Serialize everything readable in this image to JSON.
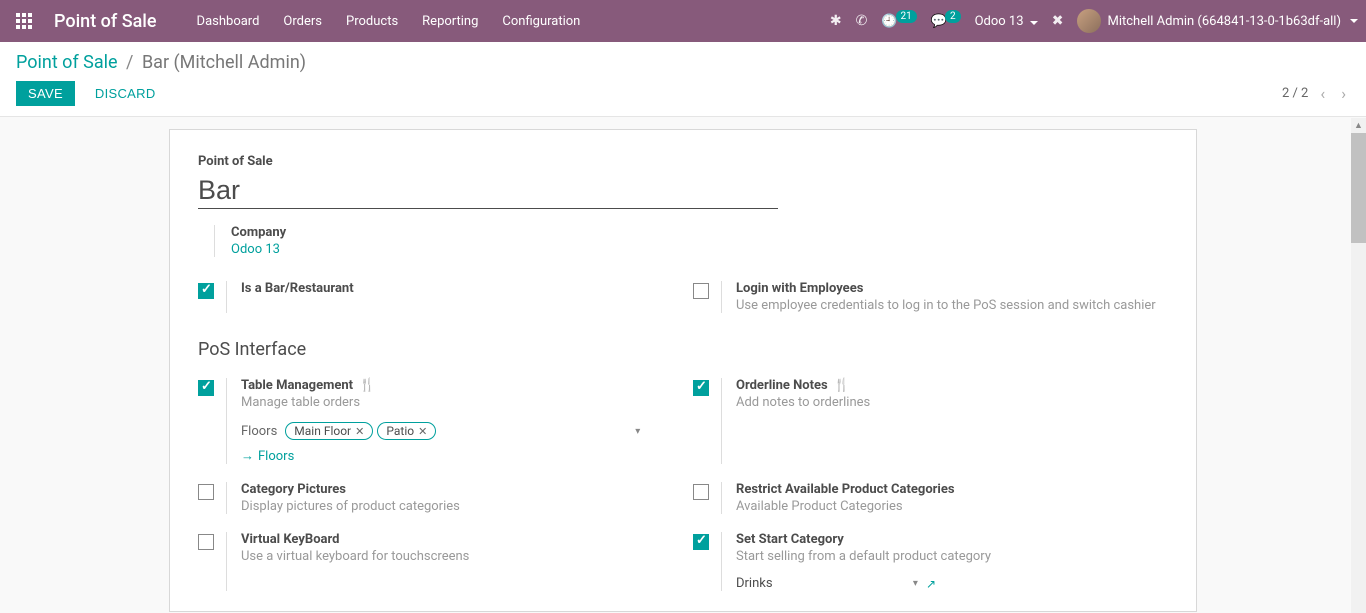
{
  "topnav": {
    "brand": "Point of Sale",
    "items": [
      "Dashboard",
      "Orders",
      "Products",
      "Reporting",
      "Configuration"
    ],
    "clock_badge": "21",
    "chat_badge": "2",
    "db_name": "Odoo 13",
    "user_name": "Mitchell Admin (664841-13-0-1b63df-all)"
  },
  "breadcrumb": {
    "root": "Point of Sale",
    "current": "Bar (Mitchell Admin)"
  },
  "actions": {
    "save": "SAVE",
    "discard": "DISCARD",
    "pager": "2 / 2"
  },
  "form": {
    "title_label": "Point of Sale",
    "title_value": "Bar",
    "company_label": "Company",
    "company_value": "Odoo 13",
    "section_pos_interface": "PoS Interface",
    "settings": {
      "is_bar": {
        "label": "Is a Bar/Restaurant"
      },
      "login_employees": {
        "label": "Login with Employees",
        "desc": "Use employee credentials to log in to the PoS session and switch cashier"
      },
      "table_mgmt": {
        "label": "Table Management",
        "desc": "Manage table orders",
        "floors_label": "Floors",
        "tags": [
          "Main Floor",
          "Patio"
        ],
        "floors_link": "Floors"
      },
      "orderline_notes": {
        "label": "Orderline Notes",
        "desc": "Add notes to orderlines"
      },
      "category_pictures": {
        "label": "Category Pictures",
        "desc": "Display pictures of product categories"
      },
      "restrict_categories": {
        "label": "Restrict Available Product Categories",
        "desc": "Available Product Categories"
      },
      "virtual_keyboard": {
        "label": "Virtual KeyBoard",
        "desc": "Use a virtual keyboard for touchscreens"
      },
      "start_category": {
        "label": "Set Start Category",
        "desc": "Start selling from a default product category",
        "value": "Drinks"
      }
    }
  }
}
